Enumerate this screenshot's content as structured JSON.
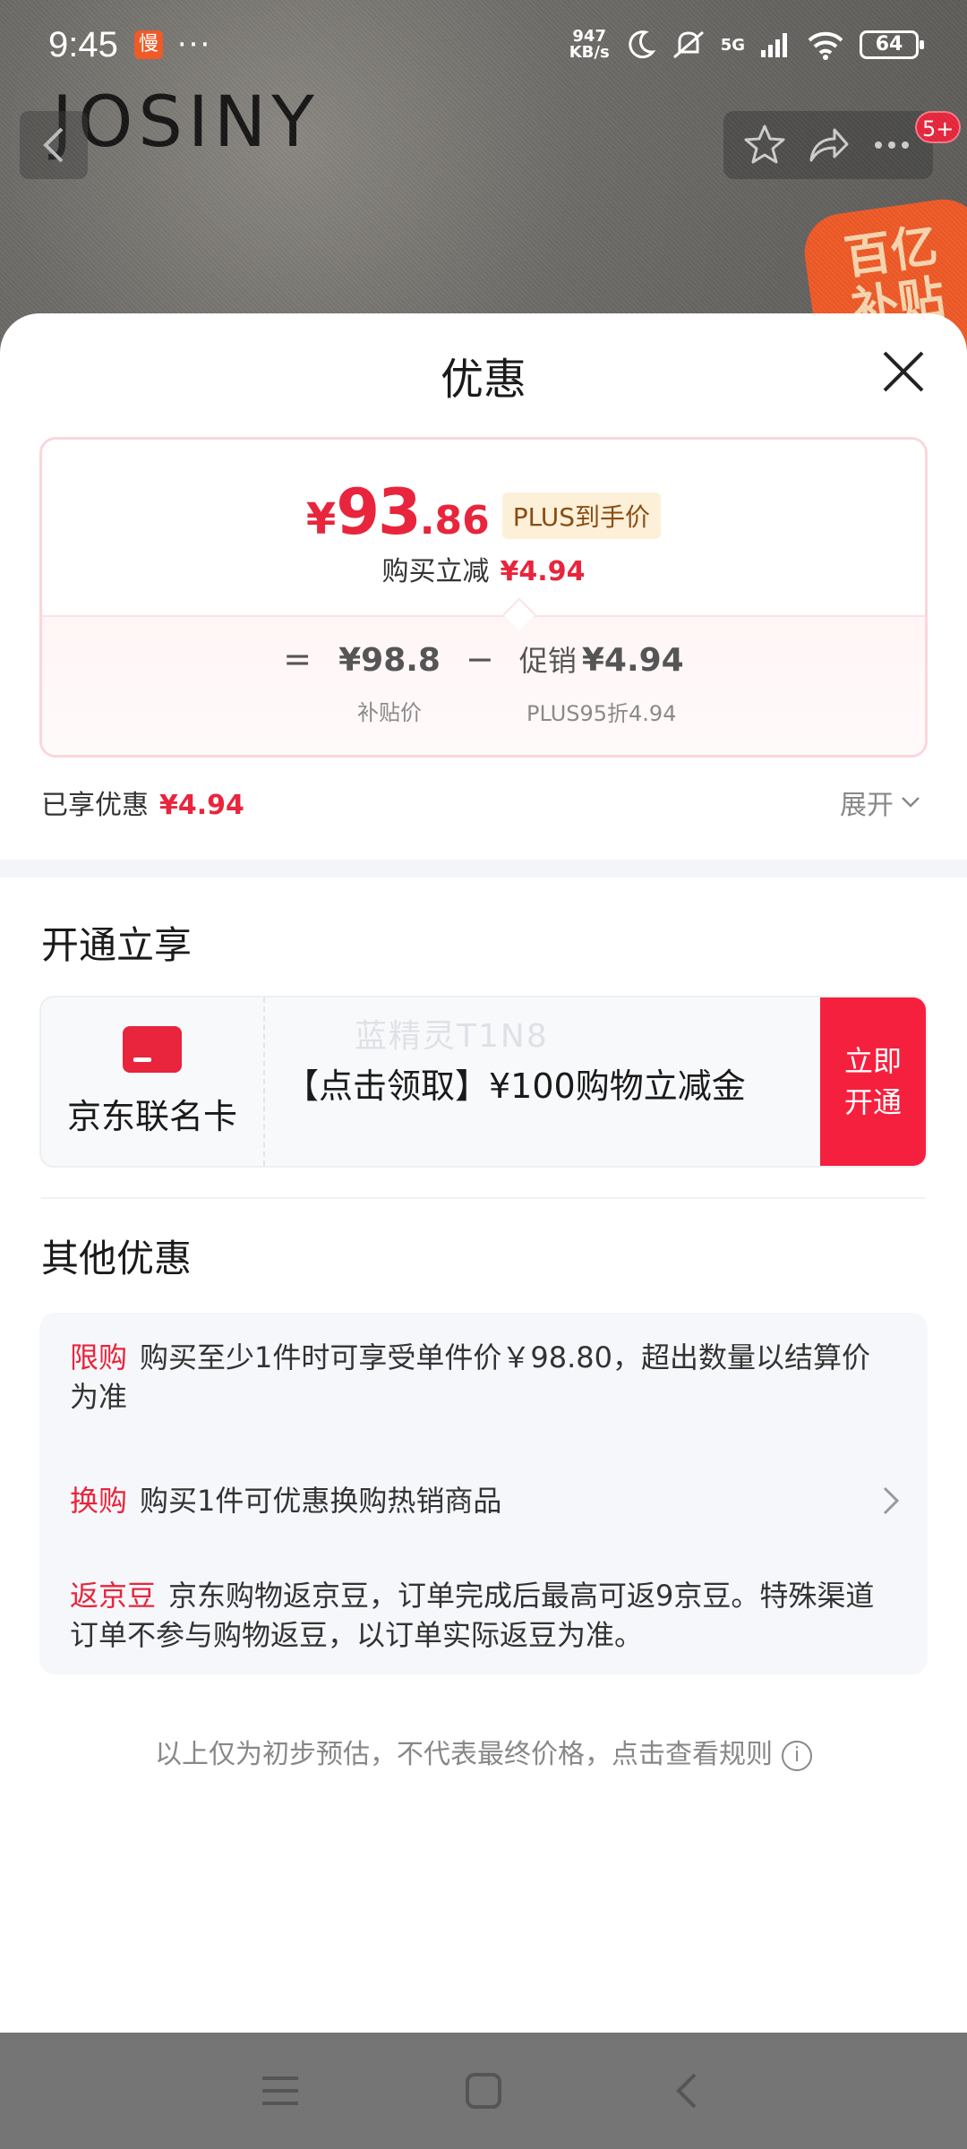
{
  "status_bar": {
    "time": "9:45",
    "slow_badge": "慢",
    "dots": "···",
    "net_speed_value": "947",
    "net_speed_unit": "KB/s",
    "network": "5G",
    "battery": "64"
  },
  "background_page": {
    "brand": "JOSINY",
    "badge_count": "5+",
    "promo_badge_line1": "百亿",
    "promo_badge_line2": "补贴"
  },
  "sheet": {
    "title": "优惠",
    "price_card": {
      "currency": "¥",
      "price_integer": "93",
      "price_decimal": ".86",
      "plus_tag": "PLUS到手价",
      "reduce_label": "购买立减",
      "reduce_amount": "¥4.94",
      "equals": "=",
      "base_price": "¥98.8",
      "base_label": "补贴价",
      "minus": "−",
      "promo_label": "促销",
      "promo_amount": "¥4.94",
      "promo_sublabel": "PLUS95折4.94"
    },
    "enjoyed": {
      "label": "已享优惠",
      "amount": "¥4.94",
      "expand": "展开"
    },
    "membership": {
      "title": "开通立享",
      "card_name": "京东联名卡",
      "offer": "【点击领取】¥100购物立减金",
      "watermark": "蓝精灵T1N8",
      "button_line1": "立即",
      "button_line2": "开通"
    },
    "other": {
      "title": "其他优惠",
      "items": [
        {
          "tag": "限购",
          "text": "购买至少1件时可享受单件价￥98.80，超出数量以结算价为准"
        },
        {
          "tag": "换购",
          "text": "购买1件可优惠换购热销商品"
        },
        {
          "tag": "返京豆",
          "text": "京东购物返京豆，订单完成后最高可返9京豆。特殊渠道订单不参与购物返豆，以订单实际返豆为准。"
        }
      ]
    },
    "footer_note": "以上仅为初步预估，不代表最终价格，点击查看规则",
    "info_icon": "i"
  },
  "colors": {
    "accent_red": "#e8253c",
    "button_red": "#f5203e",
    "plus_tag_bg": "#fdf0d9"
  }
}
